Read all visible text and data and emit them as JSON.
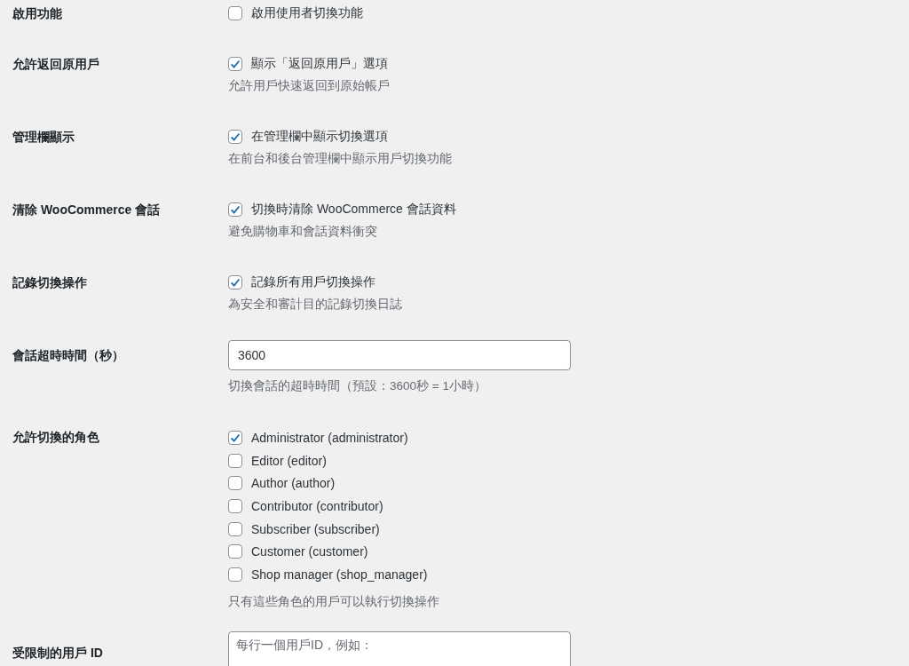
{
  "settings": [
    {
      "kind": "checkbox",
      "label": "啟用功能",
      "option": "啟用使用者切換功能",
      "checked": false
    },
    {
      "kind": "checkbox",
      "label": "允許返回原用戶",
      "option": "顯示「返回原用戶」選項",
      "checked": true,
      "description": "允許用戶快速返回到原始帳戶"
    },
    {
      "kind": "checkbox",
      "label": "管理欄顯示",
      "option": "在管理欄中顯示切換選項",
      "checked": true,
      "description": "在前台和後台管理欄中顯示用戶切換功能"
    },
    {
      "kind": "checkbox",
      "label": "清除 WooCommerce 會話",
      "option": "切換時清除 WooCommerce 會話資料",
      "checked": true,
      "description": "避免購物車和會話資料衝突"
    },
    {
      "kind": "checkbox",
      "label": "記錄切換操作",
      "option": "記錄所有用戶切換操作",
      "checked": true,
      "description": "為安全和審計目的記錄切換日誌"
    },
    {
      "kind": "text",
      "label": "會話超時時間（秒）",
      "value": "3600",
      "description": "切換會話的超時時間（預設：3600秒 = 1小時）"
    },
    {
      "kind": "checkbox_group",
      "label": "允許切換的角色",
      "options": [
        {
          "label": "Administrator (administrator)",
          "checked": true
        },
        {
          "label": "Editor (editor)",
          "checked": false
        },
        {
          "label": "Author (author)",
          "checked": false
        },
        {
          "label": "Contributor (contributor)",
          "checked": false
        },
        {
          "label": "Subscriber (subscriber)",
          "checked": false
        },
        {
          "label": "Customer (customer)",
          "checked": false
        },
        {
          "label": "Shop manager (shop_manager)",
          "checked": false
        }
      ],
      "description": "只有這些角色的用戶可以執行切換操作"
    },
    {
      "kind": "textarea",
      "label": "受限制的用戶 ID",
      "placeholder": "每行一個用戶ID，例如："
    }
  ]
}
